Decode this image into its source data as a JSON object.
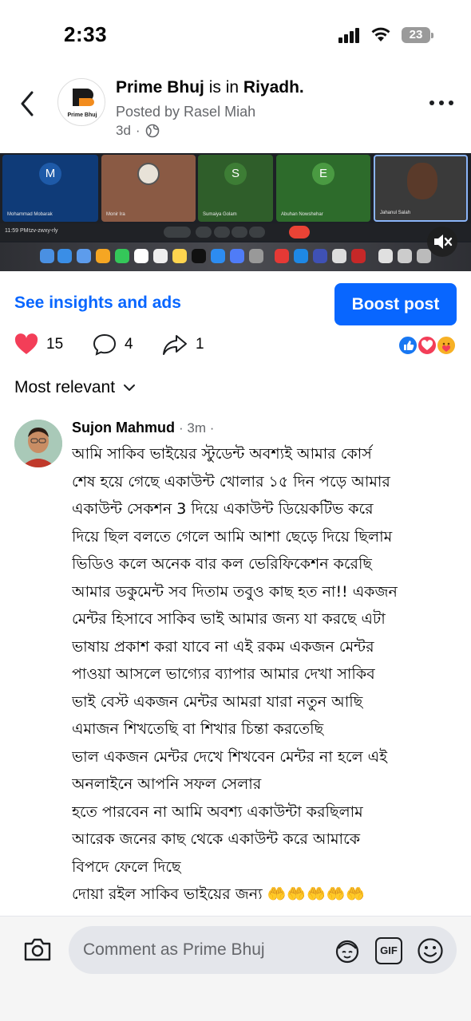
{
  "status_bar": {
    "time": "2:33",
    "battery": "23"
  },
  "header": {
    "page_name": "Prime Bhuj",
    "is_in": "is in",
    "location": "Riyadh.",
    "posted_by": "Posted by Rasel Miah",
    "age": "3d",
    "logo_text": "Prime Bhuj",
    "icons": [
      "back-arrow-icon",
      "globe-icon",
      "more-icon"
    ]
  },
  "media": {
    "tiles": [
      {
        "initial": "M",
        "name": "Mohammad Mobarak",
        "color": "#1e5aa8"
      },
      {
        "initial": "",
        "name": "Monir Ira",
        "color": "#7b5a4a"
      },
      {
        "initial": "S",
        "name": "Sumaiya Golam",
        "color": "#2e8b3a"
      },
      {
        "initial": "E",
        "name": "Abuhan Nowshehar",
        "color": "#3a8f3a"
      },
      {
        "initial": "",
        "name": "Jahanul Salah",
        "color": "#3b3b3b"
      }
    ],
    "clock": "11:59 PM",
    "meeting_code": "tzv-zwxy-rly"
  },
  "actions": {
    "insights_label": "See insights and ads",
    "boost_label": "Boost post"
  },
  "reactions": {
    "likes": "15",
    "comments": "4",
    "shares": "1"
  },
  "sort": {
    "label": "Most relevant"
  },
  "comment": {
    "author": "Sujon Mahmud",
    "time": "3m",
    "lines": [
      "আমি সাকিব ভাইয়ের স্টুডেন্ট অবশ্যই আমার কোর্স",
      "শেষ হয়ে গেছে একাউন্ট খোলার ১৫ দিন পড়ে আমার",
      "একাউন্ট সেকশন 3 দিয়ে একাউন্ট ডিয়েকটিভ করে",
      "দিয়ে ছিল বলতে গেলে আমি আশা ছেড়ে দিয়ে ছিলাম",
      "ভিডিও কলে অনেক বার কল ভেরিফিকেশন করেছি",
      "আমার ডকুমেন্ট সব দিতাম তবুও কাছ হত না!! একজন",
      "মেন্টর হিসাবে সাকিব ভাই আমার জন্য যা করছে এটা",
      "ভাষায় প্রকাশ করা যাবে না এই রকম একজন মেন্টর",
      "পাওয়া আসলে ভাগ্যের ব্যাপার আমার দেখা সাকিব",
      "ভাই বেস্ট একজন মেন্টর আমরা যারা নতুন আছি",
      "এমাজন শিখতেছি বা শিখার চিন্তা করতেছি",
      "ভাল একজন মেন্টর দেখে শিখবেন মেন্টর না হলে এই",
      "অনলাইনে আপনি সফল সেলার",
      "হতে পারবেন না আমি অবশ্য একাউন্টা করছিলাম",
      "আরেক জনের কাছ থেকে একাউন্ট করে আমাকে",
      "বিপদে ফেলে দিছে",
      "দোয়া রইল সাকিব ভাইয়ের জন্য"
    ],
    "emoji": "🤲🤲🤲🤲🤲"
  },
  "composer": {
    "placeholder": "Comment as Prime Bhuj",
    "gif_label": "GIF"
  },
  "colors": {
    "accent": "#0866ff",
    "secondary_text": "#65676b",
    "love": "#f33e58"
  }
}
